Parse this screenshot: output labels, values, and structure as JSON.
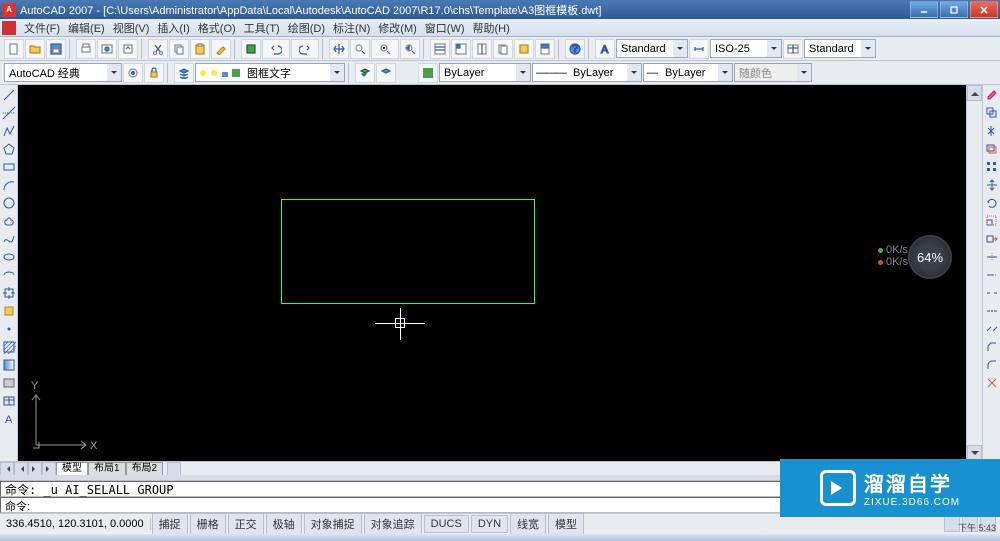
{
  "title": "AutoCAD 2007 - [C:\\Users\\Administrator\\AppData\\Local\\Autodesk\\AutoCAD 2007\\R17.0\\chs\\Template\\A3图框模板.dwt]",
  "menus": [
    "文件(F)",
    "编辑(E)",
    "视图(V)",
    "插入(I)",
    "格式(O)",
    "工具(T)",
    "绘图(D)",
    "标注(N)",
    "修改(M)",
    "窗口(W)",
    "帮助(H)"
  ],
  "workspace_dd": "AutoCAD 经典",
  "layerstate_dd": "图框文字",
  "textstyle_dd": "Standard",
  "dimstyle_dd": "ISO-25",
  "tablestyle_dd": "Standard",
  "layer_dd": "ByLayer",
  "linetype_dd": "ByLayer",
  "lineweight_dd": "ByLayer",
  "color_dd": "随颜色",
  "tabs": {
    "model": "模型",
    "layout1": "布局1",
    "layout2": "布局2"
  },
  "cmd1": "命令: _u AI_SELALL GROUP",
  "cmd2": "命令:",
  "coords": "336.4510, 120.3101, 0.0000",
  "status_btns": [
    "捕捉",
    "栅格",
    "正交",
    "极轴",
    "对象捕捉",
    "对象追踪",
    "DUCS",
    "DYN",
    "线宽",
    "模型"
  ],
  "ucs": {
    "x": "X",
    "y": "Y"
  },
  "overlay": {
    "pct": "64%",
    "up": "0K/s",
    "dn": "0K/s"
  },
  "watermark": {
    "big": "溜溜自学",
    "small": "ZIXUE.3D66.COM"
  },
  "clock": "下午 5:43"
}
